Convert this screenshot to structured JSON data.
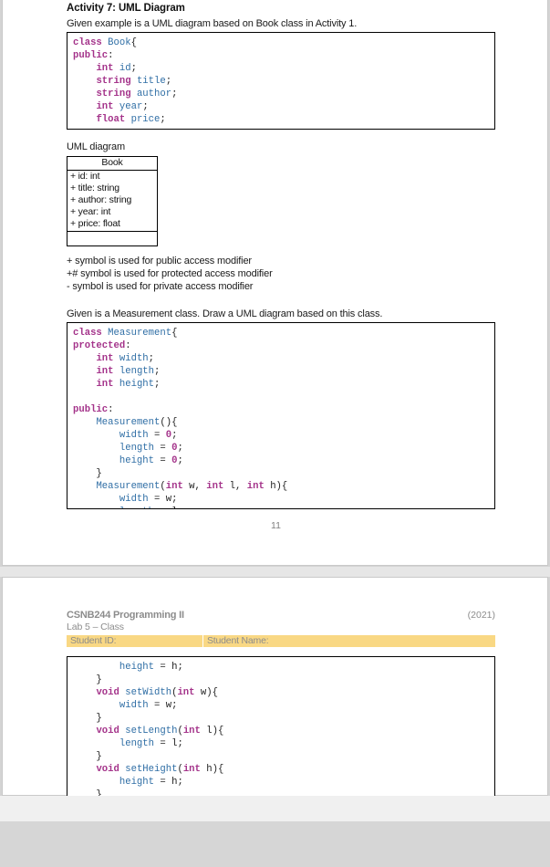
{
  "document": {
    "page_number": "11",
    "header": {
      "course": "CSNB244 Programming II",
      "year": "(2021)",
      "lab": "Lab 5 – Class",
      "student_id_label": "Student ID:",
      "student_name_label": "Student Name:"
    },
    "colors": {
      "keyword": "#a4338a",
      "identifier": "#2f6ea5",
      "banner": "#f9d884",
      "header_text": "#8c8c8c",
      "page_background": "#d4d4d4"
    }
  },
  "activity": {
    "title": "Activity 7: UML Diagram",
    "intro": "Given example is a UML diagram based on Book class in Activity 1.",
    "uml_caption": "UML diagram",
    "task": "Given is a Measurement class. Draw a UML diagram based on this class."
  },
  "code_book": [
    [
      {
        "t": "class",
        "c": "kw"
      },
      {
        "t": " ",
        "c": "pl"
      },
      {
        "t": "Book",
        "c": "id"
      },
      {
        "t": "{",
        "c": "pl"
      }
    ],
    [
      {
        "t": "public",
        "c": "kw"
      },
      {
        "t": ":",
        "c": "pl"
      }
    ],
    [
      {
        "t": "    ",
        "c": "pl"
      },
      {
        "t": "int",
        "c": "kw"
      },
      {
        "t": " ",
        "c": "pl"
      },
      {
        "t": "id",
        "c": "id"
      },
      {
        "t": ";",
        "c": "pl"
      }
    ],
    [
      {
        "t": "    ",
        "c": "pl"
      },
      {
        "t": "string",
        "c": "kw"
      },
      {
        "t": " ",
        "c": "pl"
      },
      {
        "t": "title",
        "c": "id"
      },
      {
        "t": ";",
        "c": "pl"
      }
    ],
    [
      {
        "t": "    ",
        "c": "pl"
      },
      {
        "t": "string",
        "c": "kw"
      },
      {
        "t": " ",
        "c": "pl"
      },
      {
        "t": "author",
        "c": "id"
      },
      {
        "t": ";",
        "c": "pl"
      }
    ],
    [
      {
        "t": "    ",
        "c": "pl"
      },
      {
        "t": "int",
        "c": "kw"
      },
      {
        "t": " ",
        "c": "pl"
      },
      {
        "t": "year",
        "c": "id"
      },
      {
        "t": ";",
        "c": "pl"
      }
    ],
    [
      {
        "t": "    ",
        "c": "pl"
      },
      {
        "t": "float",
        "c": "kw"
      },
      {
        "t": " ",
        "c": "pl"
      },
      {
        "t": "price",
        "c": "id"
      },
      {
        "t": ";",
        "c": "pl"
      }
    ],
    [
      {
        "t": "",
        "c": "pl"
      }
    ],
    [
      {
        "t": "};",
        "c": "pl"
      }
    ]
  ],
  "uml_diagram": {
    "class_name": "Book",
    "attributes": [
      "+ id: int",
      "+ title: string",
      "+ author: string",
      "+ year: int",
      "+ price: float"
    ],
    "has_empty_methods_row": true
  },
  "symbol_notes": [
    "+ symbol is used for public access modifier",
    "+# symbol is used for protected access modifier",
    "- symbol is used for private access modifier"
  ],
  "code_measurement_part1": [
    [
      {
        "t": "class",
        "c": "kw"
      },
      {
        "t": " ",
        "c": "pl"
      },
      {
        "t": "Measurement",
        "c": "id"
      },
      {
        "t": "{",
        "c": "pl"
      }
    ],
    [
      {
        "t": "protected",
        "c": "kw"
      },
      {
        "t": ":",
        "c": "pl"
      }
    ],
    [
      {
        "t": "    ",
        "c": "pl"
      },
      {
        "t": "int",
        "c": "kw"
      },
      {
        "t": " ",
        "c": "pl"
      },
      {
        "t": "width",
        "c": "id"
      },
      {
        "t": ";",
        "c": "pl"
      }
    ],
    [
      {
        "t": "    ",
        "c": "pl"
      },
      {
        "t": "int",
        "c": "kw"
      },
      {
        "t": " ",
        "c": "pl"
      },
      {
        "t": "length",
        "c": "id"
      },
      {
        "t": ";",
        "c": "pl"
      }
    ],
    [
      {
        "t": "    ",
        "c": "pl"
      },
      {
        "t": "int",
        "c": "kw"
      },
      {
        "t": " ",
        "c": "pl"
      },
      {
        "t": "height",
        "c": "id"
      },
      {
        "t": ";",
        "c": "pl"
      }
    ],
    [
      {
        "t": "",
        "c": "pl"
      }
    ],
    [
      {
        "t": "public",
        "c": "kw"
      },
      {
        "t": ":",
        "c": "pl"
      }
    ],
    [
      {
        "t": "    ",
        "c": "pl"
      },
      {
        "t": "Measurement",
        "c": "id"
      },
      {
        "t": "(){",
        "c": "pl"
      }
    ],
    [
      {
        "t": "        ",
        "c": "pl"
      },
      {
        "t": "width",
        "c": "id"
      },
      {
        "t": " = ",
        "c": "pl"
      },
      {
        "t": "0",
        "c": "num"
      },
      {
        "t": ";",
        "c": "pl"
      }
    ],
    [
      {
        "t": "        ",
        "c": "pl"
      },
      {
        "t": "length",
        "c": "id"
      },
      {
        "t": " = ",
        "c": "pl"
      },
      {
        "t": "0",
        "c": "num"
      },
      {
        "t": ";",
        "c": "pl"
      }
    ],
    [
      {
        "t": "        ",
        "c": "pl"
      },
      {
        "t": "height",
        "c": "id"
      },
      {
        "t": " = ",
        "c": "pl"
      },
      {
        "t": "0",
        "c": "num"
      },
      {
        "t": ";",
        "c": "pl"
      }
    ],
    [
      {
        "t": "    }",
        "c": "pl"
      }
    ],
    [
      {
        "t": "    ",
        "c": "pl"
      },
      {
        "t": "Measurement",
        "c": "id"
      },
      {
        "t": "(",
        "c": "pl"
      },
      {
        "t": "int",
        "c": "kw"
      },
      {
        "t": " w, ",
        "c": "pl"
      },
      {
        "t": "int",
        "c": "kw"
      },
      {
        "t": " l, ",
        "c": "pl"
      },
      {
        "t": "int",
        "c": "kw"
      },
      {
        "t": " h){",
        "c": "pl"
      }
    ],
    [
      {
        "t": "        ",
        "c": "pl"
      },
      {
        "t": "width",
        "c": "id"
      },
      {
        "t": " = w;",
        "c": "pl"
      }
    ],
    [
      {
        "t": "        ",
        "c": "pl"
      },
      {
        "t": "length",
        "c": "id"
      },
      {
        "t": " = l;",
        "c": "pl"
      }
    ]
  ],
  "code_measurement_part2": [
    [
      {
        "t": "        ",
        "c": "pl"
      },
      {
        "t": "height",
        "c": "id"
      },
      {
        "t": " = h;",
        "c": "pl"
      }
    ],
    [
      {
        "t": "    }",
        "c": "pl"
      }
    ],
    [
      {
        "t": "    ",
        "c": "pl"
      },
      {
        "t": "void",
        "c": "kw"
      },
      {
        "t": " ",
        "c": "pl"
      },
      {
        "t": "setWidth",
        "c": "id"
      },
      {
        "t": "(",
        "c": "pl"
      },
      {
        "t": "int",
        "c": "kw"
      },
      {
        "t": " w){",
        "c": "pl"
      }
    ],
    [
      {
        "t": "        ",
        "c": "pl"
      },
      {
        "t": "width",
        "c": "id"
      },
      {
        "t": " = w;",
        "c": "pl"
      }
    ],
    [
      {
        "t": "    }",
        "c": "pl"
      }
    ],
    [
      {
        "t": "    ",
        "c": "pl"
      },
      {
        "t": "void",
        "c": "kw"
      },
      {
        "t": " ",
        "c": "pl"
      },
      {
        "t": "setLength",
        "c": "id"
      },
      {
        "t": "(",
        "c": "pl"
      },
      {
        "t": "int",
        "c": "kw"
      },
      {
        "t": " l){",
        "c": "pl"
      }
    ],
    [
      {
        "t": "        ",
        "c": "pl"
      },
      {
        "t": "length",
        "c": "id"
      },
      {
        "t": " = l;",
        "c": "pl"
      }
    ],
    [
      {
        "t": "    }",
        "c": "pl"
      }
    ],
    [
      {
        "t": "    ",
        "c": "pl"
      },
      {
        "t": "void",
        "c": "kw"
      },
      {
        "t": " ",
        "c": "pl"
      },
      {
        "t": "setHeight",
        "c": "id"
      },
      {
        "t": "(",
        "c": "pl"
      },
      {
        "t": "int",
        "c": "kw"
      },
      {
        "t": " h){",
        "c": "pl"
      }
    ],
    [
      {
        "t": "        ",
        "c": "pl"
      },
      {
        "t": "height",
        "c": "id"
      },
      {
        "t": " = h;",
        "c": "pl"
      }
    ],
    [
      {
        "t": "    }",
        "c": "pl"
      }
    ]
  ]
}
